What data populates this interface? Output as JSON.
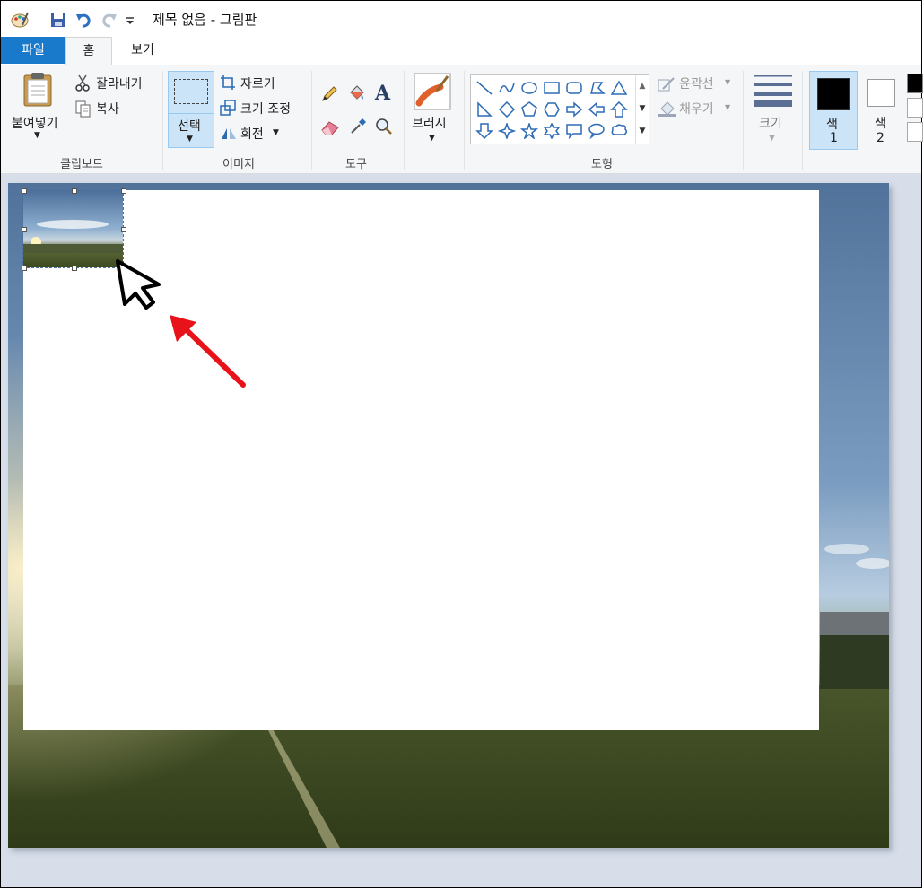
{
  "window": {
    "title": "제목 없음 - 그림판"
  },
  "tabs": [
    {
      "label": "파일"
    },
    {
      "label": "홈"
    },
    {
      "label": "보기"
    }
  ],
  "clipboard": {
    "paste_label": "붙여넣기",
    "cut_label": "잘라내기",
    "copy_label": "복사",
    "group_label": "클립보드"
  },
  "image": {
    "select_label": "선택",
    "crop_label": "자르기",
    "resize_label": "크기 조정",
    "rotate_label": "회전",
    "group_label": "이미지"
  },
  "tools": {
    "group_label": "도구",
    "text_glyph": "A"
  },
  "brushes": {
    "label": "브러시"
  },
  "shapes": {
    "outline_label": "윤곽선",
    "fill_label": "채우기",
    "group_label": "도형"
  },
  "size": {
    "label": "크기"
  },
  "colors": {
    "color1_label": "색",
    "color1_num": "1",
    "color2_label": "색",
    "color2_num": "2",
    "color1_value": "#000000",
    "color2_value": "#ffffff",
    "accent": "#1979ca",
    "selection_highlight": "#cce4f7"
  }
}
